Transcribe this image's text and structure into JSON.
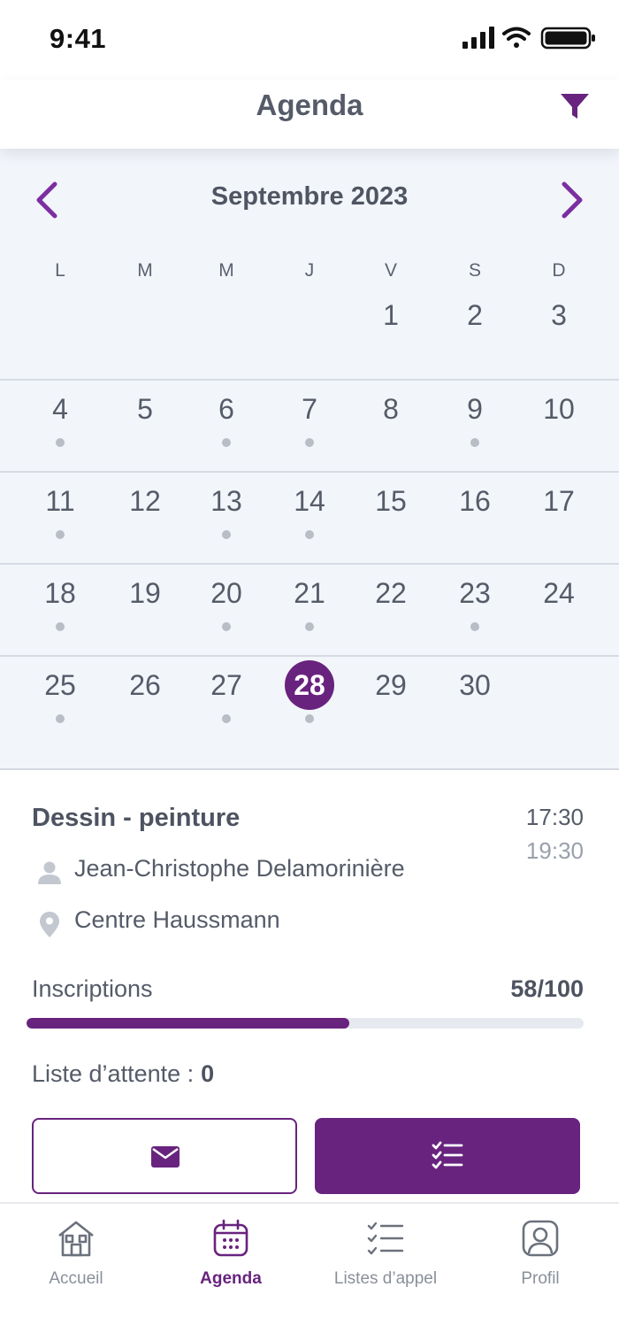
{
  "status_bar": {
    "time": "9:41"
  },
  "header": {
    "title": "Agenda",
    "filter_icon": "filter-icon"
  },
  "calendar": {
    "month_title": "Septembre 2023",
    "weekdays": [
      "L",
      "M",
      "M",
      "J",
      "V",
      "S",
      "D"
    ],
    "selected_day": "28",
    "weeks": [
      [
        {
          "d": ""
        },
        {
          "d": ""
        },
        {
          "d": ""
        },
        {
          "d": ""
        },
        {
          "d": "1"
        },
        {
          "d": "2"
        },
        {
          "d": "3"
        }
      ],
      [
        {
          "d": "4",
          "dot": true
        },
        {
          "d": "5"
        },
        {
          "d": "6",
          "dot": true
        },
        {
          "d": "7",
          "dot": true
        },
        {
          "d": "8"
        },
        {
          "d": "9",
          "dot": true
        },
        {
          "d": "10"
        }
      ],
      [
        {
          "d": "11",
          "dot": true
        },
        {
          "d": "12"
        },
        {
          "d": "13",
          "dot": true
        },
        {
          "d": "14",
          "dot": true
        },
        {
          "d": "15"
        },
        {
          "d": "16"
        },
        {
          "d": "17"
        }
      ],
      [
        {
          "d": "18",
          "dot": true
        },
        {
          "d": "19"
        },
        {
          "d": "20",
          "dot": true
        },
        {
          "d": "21",
          "dot": true
        },
        {
          "d": "22"
        },
        {
          "d": "23",
          "dot": true
        },
        {
          "d": "24"
        }
      ],
      [
        {
          "d": "25",
          "dot": true
        },
        {
          "d": "26"
        },
        {
          "d": "27",
          "dot": true
        },
        {
          "d": "28",
          "dot": true,
          "selected": true
        },
        {
          "d": "29"
        },
        {
          "d": "30"
        },
        {
          "d": ""
        }
      ]
    ]
  },
  "event": {
    "title": "Dessin - peinture",
    "time_start": "17:30",
    "time_end": "19:30",
    "teacher": "Jean-Christophe Delamorinière",
    "location": "Centre Haussmann",
    "inscriptions_label": "Inscriptions",
    "inscriptions_count": "58/100",
    "inscriptions_fraction": 0.58,
    "waitlist_label": "Liste d’attente :",
    "waitlist_value": "0"
  },
  "bottom_nav": {
    "tabs": [
      {
        "label": "Accueil",
        "icon": "home-icon",
        "active": false
      },
      {
        "label": "Agenda",
        "icon": "calendar-icon",
        "active": true
      },
      {
        "label": "Listes d’appel",
        "icon": "checklist-icon",
        "active": false
      },
      {
        "label": "Profil",
        "icon": "profile-icon",
        "active": false
      }
    ]
  },
  "colors": {
    "accent": "#68237e",
    "calendar_bg": "#f2f5fa",
    "dot": "#b8bdc6"
  }
}
